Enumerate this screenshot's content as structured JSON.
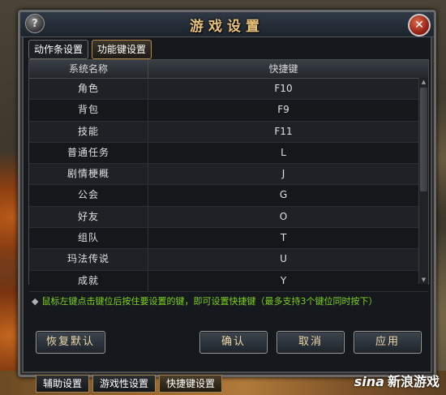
{
  "dialog": {
    "title": "游戏设置",
    "help_label": "?",
    "close_label": "✕"
  },
  "tabs": [
    {
      "label": "动作条设置",
      "active": false
    },
    {
      "label": "功能键设置",
      "active": true
    }
  ],
  "table": {
    "headers": [
      "系统名称",
      "快捷键"
    ],
    "rows": [
      {
        "name": "角色",
        "key": "F10"
      },
      {
        "name": "背包",
        "key": "F9"
      },
      {
        "name": "技能",
        "key": "F11"
      },
      {
        "name": "普通任务",
        "key": "L"
      },
      {
        "name": "剧情梗概",
        "key": "J"
      },
      {
        "name": "公会",
        "key": "G"
      },
      {
        "name": "好友",
        "key": "O"
      },
      {
        "name": "组队",
        "key": "T"
      },
      {
        "name": "玛法传说",
        "key": "U"
      },
      {
        "name": "成就",
        "key": "Y"
      }
    ]
  },
  "hint": {
    "bullet": "◆",
    "text": "鼠标左键点击键位后按住要设置的键，即可设置快捷键（最多支持3个键位同时按下）"
  },
  "buttons": {
    "restore_default": "恢复默认",
    "confirm": "确认",
    "cancel": "取消",
    "apply": "应用"
  },
  "bottom_tabs": [
    {
      "label": "辅助设置",
      "active": false
    },
    {
      "label": "游戏性设置",
      "active": false
    },
    {
      "label": "快捷键设置",
      "active": true
    }
  ],
  "watermark": {
    "brand": "sina",
    "text": "新浪游戏"
  },
  "colors": {
    "title_gold": "#e9c27a",
    "hint_green": "#7ed321",
    "button_text": "#f0d9a8"
  }
}
